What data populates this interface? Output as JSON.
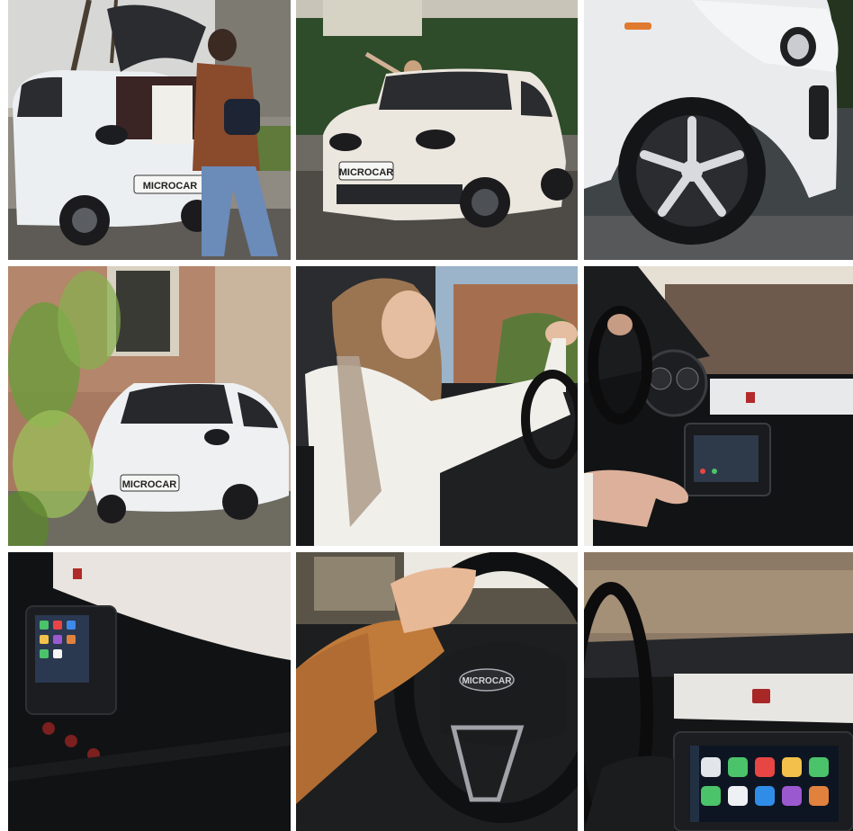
{
  "gallery": {
    "plate_text": "MICROCAR",
    "hood_badge": "MICROCAR",
    "tiles": [
      {
        "id": "tile-1",
        "description": "white microcar rear with woman loading bags"
      },
      {
        "id": "tile-2",
        "description": "white microcar front with woman waving"
      },
      {
        "id": "tile-3",
        "description": "white microcar wheel close-up"
      },
      {
        "id": "tile-4",
        "description": "white microcar rear three-quarter view by brick building"
      },
      {
        "id": "tile-5",
        "description": "smiling woman driving"
      },
      {
        "id": "tile-6",
        "description": "dashboard with hand on steering wheel and touchscreen"
      },
      {
        "id": "tile-7",
        "description": "dark dashboard with infotainment screen"
      },
      {
        "id": "tile-8",
        "description": "hand on steering wheel with logo"
      },
      {
        "id": "tile-9",
        "description": "infotainment screen with app icons"
      }
    ]
  },
  "colors": {
    "car_white": "#eceff2",
    "dash_black": "#151618",
    "sweater_orange": "#c07a3a",
    "hedge_green": "#2e4b2a"
  }
}
